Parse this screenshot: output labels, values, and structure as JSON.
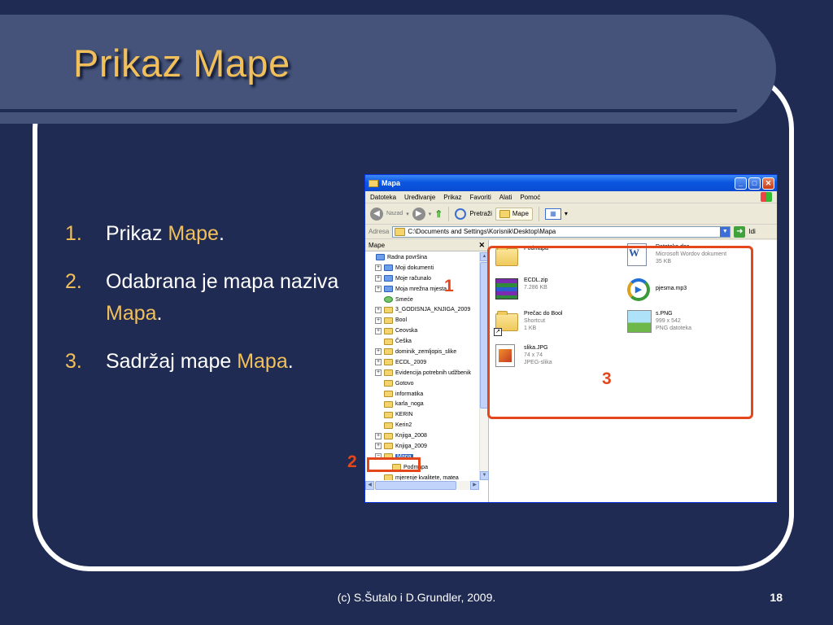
{
  "slide": {
    "title": "Prikaz Mape",
    "bullets": [
      {
        "num": "1.",
        "text": "Prikaz ",
        "highlight": "Mape",
        "suffix": "."
      },
      {
        "num": "2.",
        "text": "Odabrana je mapa naziva ",
        "highlight": "Mapa",
        "suffix": "."
      },
      {
        "num": "3.",
        "text": "Sadržaj mape ",
        "highlight": "Mapa",
        "suffix": "."
      }
    ],
    "footer": "(c) S.Šutalo i D.Grundler, 2009.",
    "page_number": "18",
    "annotations": {
      "n1": "1",
      "n2": "2",
      "n3": "3"
    }
  },
  "window": {
    "title": "Mapa",
    "menu": [
      "Datoteka",
      "Uređivanje",
      "Prikaz",
      "Favoriti",
      "Alati",
      "Pomoć"
    ],
    "toolbar": {
      "back_label": "Nazad",
      "search_label": "Pretraži",
      "folders_label": "Mape"
    },
    "address": {
      "label": "Adresa",
      "value": "C:\\Documents and Settings\\Korisnik\\Desktop\\Mapa",
      "go_label": "Idi"
    },
    "tree": {
      "header": "Mape",
      "items": [
        {
          "label": "Radna površina",
          "expander": "",
          "icon": "desktop-icon",
          "indent": 0
        },
        {
          "label": "Moji dokumenti",
          "expander": "+",
          "icon": "my-documents-icon",
          "indent": 1
        },
        {
          "label": "Moje računalo",
          "expander": "+",
          "icon": "my-computer-icon",
          "indent": 1
        },
        {
          "label": "Moja mrežna mjesta",
          "expander": "+",
          "icon": "network-places-icon",
          "indent": 1
        },
        {
          "label": "Smeće",
          "expander": "",
          "icon": "recycle-bin-icon",
          "indent": 1
        },
        {
          "label": "3_GODISNJA_KNJIGA_2009",
          "expander": "+",
          "icon": "folder-icon",
          "indent": 1
        },
        {
          "label": "Bool",
          "expander": "+",
          "icon": "folder-icon",
          "indent": 1
        },
        {
          "label": "Ceovska",
          "expander": "+",
          "icon": "folder-icon",
          "indent": 1
        },
        {
          "label": "Češka",
          "expander": "",
          "icon": "folder-icon",
          "indent": 1
        },
        {
          "label": "dominik_zemljopis_slike",
          "expander": "+",
          "icon": "folder-icon",
          "indent": 1
        },
        {
          "label": "ECDL_2009",
          "expander": "+",
          "icon": "folder-icon",
          "indent": 1
        },
        {
          "label": "Evidencija potrebnih udžbenik",
          "expander": "+",
          "icon": "folder-icon",
          "indent": 1
        },
        {
          "label": "Gotovo",
          "expander": "",
          "icon": "folder-icon",
          "indent": 1
        },
        {
          "label": "informatika",
          "expander": "",
          "icon": "folder-icon",
          "indent": 1
        },
        {
          "label": "karla_noga",
          "expander": "",
          "icon": "folder-icon",
          "indent": 1
        },
        {
          "label": "KERIN",
          "expander": "",
          "icon": "folder-icon",
          "indent": 1
        },
        {
          "label": "Kerin2",
          "expander": "",
          "icon": "folder-icon",
          "indent": 1
        },
        {
          "label": "Knjiga_2008",
          "expander": "+",
          "icon": "folder-icon",
          "indent": 1
        },
        {
          "label": "Knjiga_2009",
          "expander": "+",
          "icon": "folder-icon",
          "indent": 1
        },
        {
          "label": "Mapa",
          "expander": "−",
          "icon": "open-folder-icon",
          "indent": 1,
          "selected": true
        },
        {
          "label": "Podmapa",
          "expander": "",
          "icon": "folder-icon",
          "indent": 2
        },
        {
          "label": "mjerenje kvalitete, matea",
          "expander": "",
          "icon": "folder-icon",
          "indent": 1
        }
      ]
    },
    "files": [
      {
        "name": "Podmapa",
        "meta1": "",
        "meta2": "",
        "icon": "folder-icon"
      },
      {
        "name": "Datoteka.doc",
        "meta1": "Microsoft Wordov dokument",
        "meta2": "35 KB",
        "icon": "word-document-icon"
      },
      {
        "name": "ECDL.zip",
        "meta1": "7.286 KB",
        "meta2": "",
        "icon": "winrar-archive-icon"
      },
      {
        "name": "pjesma.mp3",
        "meta1": "",
        "meta2": "",
        "icon": "media-player-icon"
      },
      {
        "name": "Prečac do Bool",
        "meta1": "Shortcut",
        "meta2": "1 KB",
        "icon": "folder-shortcut-icon"
      },
      {
        "name": "s.PNG",
        "meta1": "999 x 542",
        "meta2": "PNG datoteka",
        "icon": "png-image-icon"
      },
      {
        "name": "slika.JPG",
        "meta1": "74 x 74",
        "meta2": "JPEG-slika",
        "icon": "jpeg-image-icon"
      }
    ]
  }
}
